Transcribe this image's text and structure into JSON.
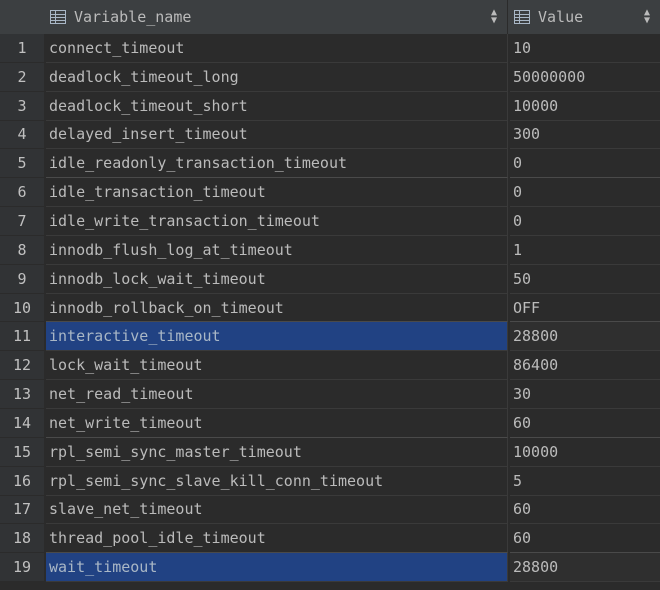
{
  "colors": {
    "background": "#2b2b2b",
    "header_bg": "#3c3f41",
    "row_number_bg": "#313335",
    "selection": "#214283",
    "text": "#bbbbbb"
  },
  "header": {
    "columns": [
      {
        "label": "Variable_name",
        "icon": "table-column-icon",
        "sort_icon": "sort-arrows-icon"
      },
      {
        "label": "Value",
        "icon": "table-column-icon",
        "sort_icon": "sort-arrows-icon"
      }
    ]
  },
  "rows": [
    {
      "n": "1",
      "name": "connect_timeout",
      "value": "10",
      "selected": false
    },
    {
      "n": "2",
      "name": "deadlock_timeout_long",
      "value": "50000000",
      "selected": false
    },
    {
      "n": "3",
      "name": "deadlock_timeout_short",
      "value": "10000",
      "selected": false
    },
    {
      "n": "4",
      "name": "delayed_insert_timeout",
      "value": "300",
      "selected": false
    },
    {
      "n": "5",
      "name": "idle_readonly_transaction_timeout",
      "value": "0",
      "selected": false
    },
    {
      "n": "6",
      "name": "idle_transaction_timeout",
      "value": "0",
      "selected": false
    },
    {
      "n": "7",
      "name": "idle_write_transaction_timeout",
      "value": "0",
      "selected": false
    },
    {
      "n": "8",
      "name": "innodb_flush_log_at_timeout",
      "value": "1",
      "selected": false
    },
    {
      "n": "9",
      "name": "innodb_lock_wait_timeout",
      "value": "50",
      "selected": false
    },
    {
      "n": "10",
      "name": "innodb_rollback_on_timeout",
      "value": "OFF",
      "selected": false
    },
    {
      "n": "11",
      "name": "interactive_timeout",
      "value": "28800",
      "selected": true
    },
    {
      "n": "12",
      "name": "lock_wait_timeout",
      "value": "86400",
      "selected": false
    },
    {
      "n": "13",
      "name": "net_read_timeout",
      "value": "30",
      "selected": false
    },
    {
      "n": "14",
      "name": "net_write_timeout",
      "value": "60",
      "selected": false
    },
    {
      "n": "15",
      "name": "rpl_semi_sync_master_timeout",
      "value": "10000",
      "selected": false
    },
    {
      "n": "16",
      "name": "rpl_semi_sync_slave_kill_conn_timeout",
      "value": "5",
      "selected": false
    },
    {
      "n": "17",
      "name": "slave_net_timeout",
      "value": "60",
      "selected": false
    },
    {
      "n": "18",
      "name": "thread_pool_idle_timeout",
      "value": "60",
      "selected": false
    },
    {
      "n": "19",
      "name": "wait_timeout",
      "value": "28800",
      "selected": true
    }
  ]
}
